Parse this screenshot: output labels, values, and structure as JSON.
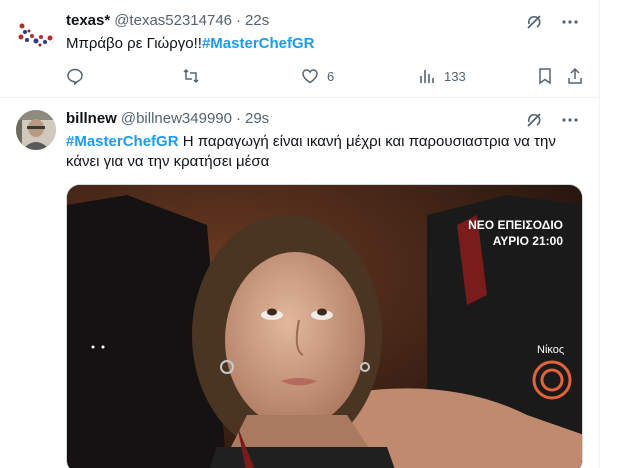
{
  "tweets": [
    {
      "name": "texas*",
      "handle": "@texas52314746",
      "separator": "·",
      "time": "22s",
      "text_plain": "Μπράβο ρε Γιώργο!!",
      "hashtag": "#MasterChefGR",
      "stats": {
        "reply": "",
        "retweet": "",
        "like": "6",
        "views": "133"
      }
    },
    {
      "name": "billnew",
      "handle": "@billnew349990",
      "separator": "·",
      "time": "29s",
      "hashtag": "#MasterChefGR",
      "text_plain": " Η παραγωγή είναι ικανή μέχρι και παρουσιαστρια να την κάνει για να την κρατήσει μέσα",
      "media": {
        "badge_line1": "ΝΕΟ ΕΠΕΙΣΟΔΙΟ",
        "badge_line2": "ΑΥΡΙΟ 21:00",
        "name_caption": "Νίκος"
      }
    }
  ],
  "icons": [
    "grok-icon",
    "more-icon",
    "reply-icon",
    "retweet-icon",
    "like-icon",
    "views-icon",
    "bookmark-icon",
    "share-icon"
  ],
  "colors": {
    "accent": "#1d9bf0",
    "secondary_text": "#536471",
    "border": "#eff3f4"
  }
}
